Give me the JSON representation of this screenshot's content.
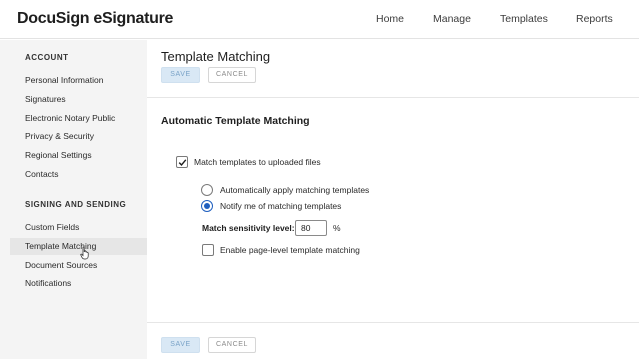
{
  "header": {
    "logo": "DocuSign eSignature",
    "nav": [
      "Home",
      "Manage",
      "Templates",
      "Reports"
    ]
  },
  "sidebar": {
    "sections": [
      {
        "heading": "ACCOUNT",
        "items": [
          "Personal Information",
          "Signatures",
          "Electronic Notary Public",
          "Privacy & Security",
          "Regional Settings",
          "Contacts"
        ]
      },
      {
        "heading": "SIGNING AND SENDING",
        "items": [
          "Custom Fields",
          "Template Matching",
          "Document Sources",
          "Notifications"
        ]
      }
    ],
    "active_item": "Template Matching"
  },
  "main": {
    "title": "Template Matching",
    "save_label": "SAVE",
    "cancel_label": "CANCEL",
    "section_title": "Automatic Template Matching",
    "match_checkbox": {
      "label": "Match templates to uploaded files",
      "checked": true
    },
    "radio_options": [
      {
        "label": "Automatically apply matching templates",
        "selected": false
      },
      {
        "label": "Notify me of matching templates",
        "selected": true
      }
    ],
    "sensitivity": {
      "label": "Match sensitivity level:",
      "value": "80",
      "unit": "%"
    },
    "page_level_checkbox": {
      "label": "Enable page-level template matching",
      "checked": false
    }
  },
  "colors": {
    "accent": "#1f5fbf",
    "save_bg": "#d9e8f5",
    "sidebar_bg": "#f4f4f4"
  }
}
